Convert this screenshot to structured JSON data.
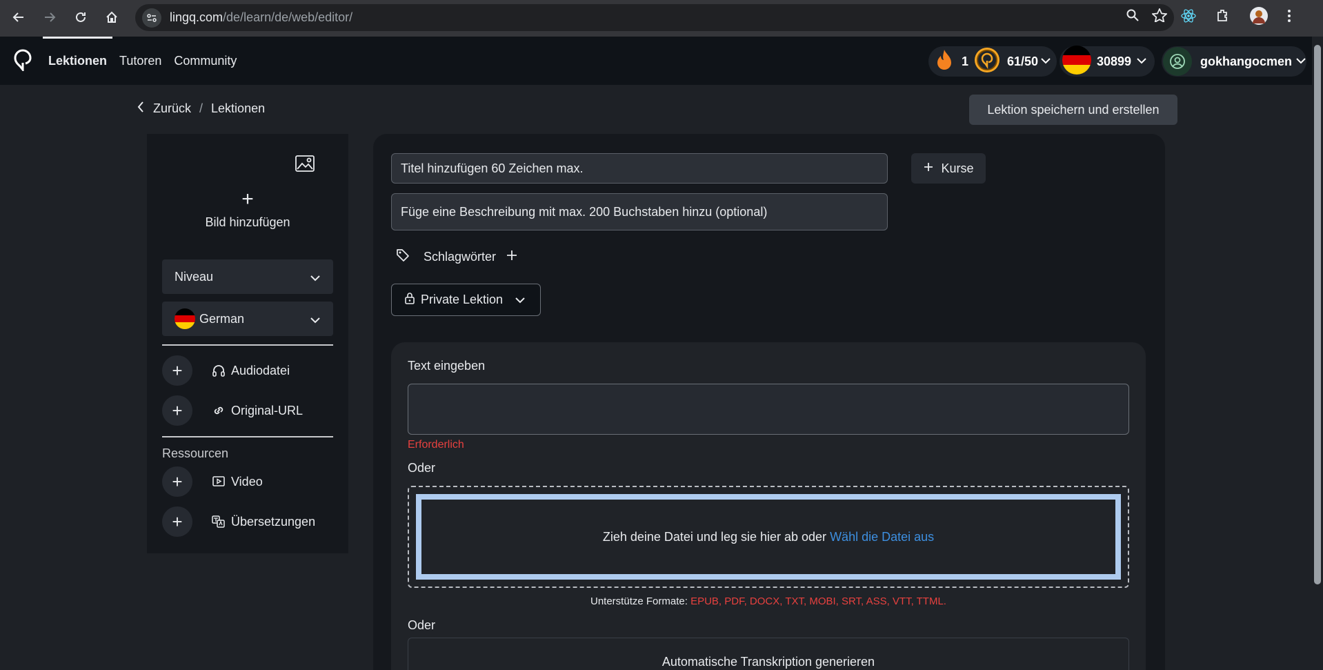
{
  "browser": {
    "url_host": "lingq.com",
    "url_path": "/de/learn/de/web/editor/"
  },
  "header": {
    "nav": [
      {
        "label": "Lektionen",
        "active": true
      },
      {
        "label": "Tutoren",
        "active": false
      },
      {
        "label": "Community",
        "active": false
      }
    ],
    "streak": "1",
    "coins": "61/50",
    "known_words": "30899",
    "username": "gokhangocmen"
  },
  "breadcrumb": {
    "back": "Zurück",
    "separator": "/",
    "current": "Lektionen"
  },
  "save_button": "Lektion speichern und erstellen",
  "sidebar": {
    "add_image": "Bild hinzufügen",
    "level": "Niveau",
    "language": "German",
    "items": [
      {
        "label": "Audiodatei",
        "icon": "headphones-icon"
      },
      {
        "label": "Original-URL",
        "icon": "link-icon"
      }
    ],
    "resources_heading": "Ressourcen",
    "resources": [
      {
        "label": "Video",
        "icon": "video-icon"
      },
      {
        "label": "Übersetzungen",
        "icon": "translate-icon"
      }
    ]
  },
  "editor": {
    "title_placeholder": "Titel hinzufügen 60 Zeichen max.",
    "description_placeholder": "Füge eine Beschreibung mit max. 200 Buchstaben hinzu (optional)",
    "courses_button": "Kurse",
    "tags_label": "Schlagwörter",
    "privacy": "Private Lektion",
    "text_label": "Text eingeben",
    "required": "Erforderlich",
    "or1": "Oder",
    "drop_text": "Zieh deine Datei und leg sie hier ab oder",
    "drop_link": "Wähl die Datei aus",
    "formats_label": "Unterstütze Formate:",
    "formats_list": "EPUB, PDF, DOCX, TXT, MOBI, SRT, ASS, VTT, TTML.",
    "or2": "Oder",
    "transcribe": "Automatische Transkription generieren"
  },
  "colors": {
    "accent_orange": "#f5a623",
    "error_red": "#e8413f",
    "link_blue": "#3d8fe0"
  }
}
